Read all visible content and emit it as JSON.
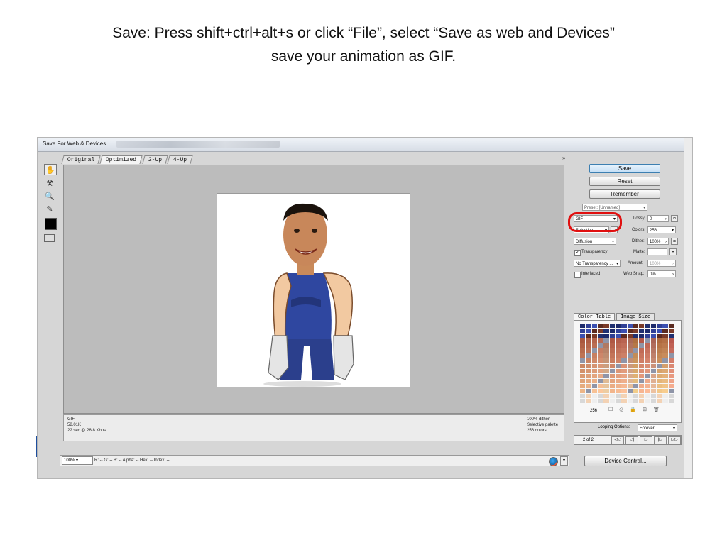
{
  "slide": {
    "title_line1": "Save: Press shift+ctrl+alt+s or click “File”, select “Save as web and Devices”",
    "title_line2": "save your animation as GIF."
  },
  "window": {
    "title": "Save For Web & Devices",
    "tabs": [
      "Original",
      "Optimized",
      "2-Up",
      "4-Up"
    ],
    "active_tab": "Optimized",
    "collapse_glyph": "»"
  },
  "tools": [
    "hand-tool",
    "slice-select-tool",
    "zoom-tool",
    "eyedropper-tool",
    "eyedropper-color",
    "toggle-slices"
  ],
  "status": {
    "left": [
      "GIF",
      "58.01K",
      "22 sec @ 28.8 Kbps"
    ],
    "right": [
      "100% dither",
      "Selective palette",
      "256 colors"
    ]
  },
  "buttons": {
    "save": "Save",
    "reset": "Reset",
    "remember": "Remember",
    "device_central": "Device Central..."
  },
  "settings": {
    "preset": "Preset: [Unnamed]",
    "format": "GIF",
    "lossy_label": "Lossy:",
    "lossy_value": "0",
    "reduction": "Selective",
    "colors_label": "Colors:",
    "colors_value": "256",
    "dither_algo": "Diffusion",
    "dither_label": "Dither:",
    "dither_value": "100%",
    "transparency_label": "Transparency",
    "transparency_checked": true,
    "matte_label": "Matte:",
    "trans_dither": "No Transparency ...",
    "amount_label": "Amount:",
    "amount_value": "100%",
    "interlaced_label": "Interlaced",
    "interlaced_checked": false,
    "websnap_label": "Web Snap:",
    "websnap_value": "0%"
  },
  "panel_tabs": [
    "Color Table",
    "Image Size"
  ],
  "color_table": {
    "count": "256"
  },
  "animation": {
    "looping_label": "Looping Options:",
    "looping_value": "Forever",
    "frame": "2 of 2"
  },
  "bottom": {
    "zoom": "100%",
    "info": "R:  --  G:  --  B:  --  Alpha:  --  Hex:  --  Index:  --"
  },
  "colors": {
    "highlight": "#e01010",
    "save_button": "#c3def5"
  }
}
